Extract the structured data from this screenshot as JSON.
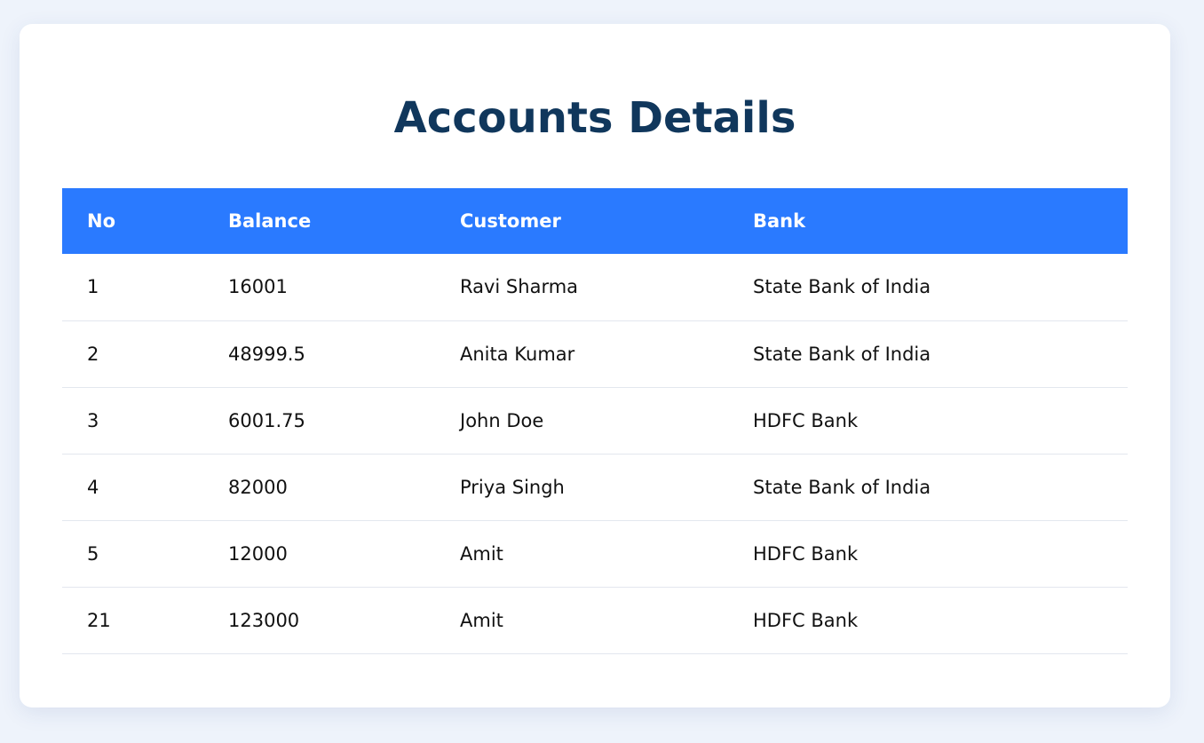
{
  "page": {
    "title": "Accounts Details"
  },
  "table": {
    "headers": {
      "no": "No",
      "balance": "Balance",
      "customer": "Customer",
      "bank": "Bank"
    },
    "rows": [
      {
        "no": "1",
        "balance": "16001",
        "customer": "Ravi Sharma",
        "bank": "State Bank of India"
      },
      {
        "no": "2",
        "balance": "48999.5",
        "customer": "Anita Kumar",
        "bank": "State Bank of India"
      },
      {
        "no": "3",
        "balance": "6001.75",
        "customer": "John Doe",
        "bank": "HDFC Bank"
      },
      {
        "no": "4",
        "balance": "82000",
        "customer": "Priya Singh",
        "bank": "State Bank of India"
      },
      {
        "no": "5",
        "balance": "12000",
        "customer": "Amit",
        "bank": "HDFC Bank"
      },
      {
        "no": "21",
        "balance": "123000",
        "customer": "Amit",
        "bank": "HDFC Bank"
      }
    ]
  },
  "colors": {
    "page_background": "#eef3fb",
    "card_background": "#ffffff",
    "title": "#10375c",
    "header_background": "#2a7aff",
    "header_text": "#ffffff",
    "row_divider": "#e3e7ee"
  }
}
